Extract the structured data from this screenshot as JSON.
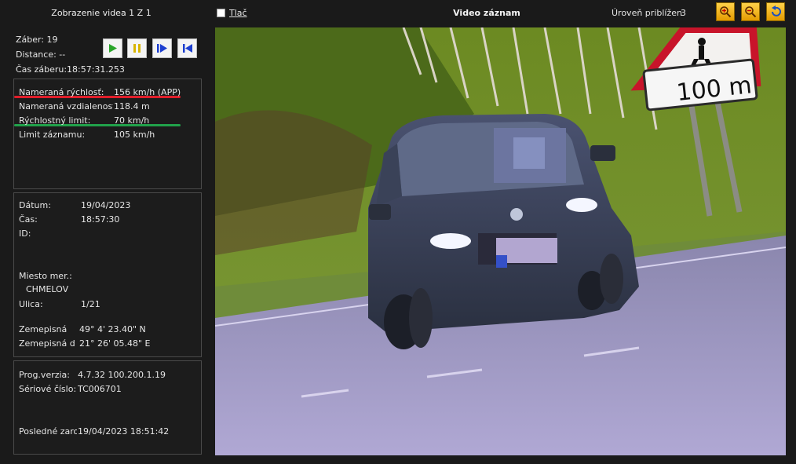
{
  "left_panel": {
    "title": "Zobrazenie videa 1 Z 1",
    "frame": "Záber: 19",
    "distance": "Distance: --",
    "time_label": "Čas záberu:",
    "time_value": "18:57:31.253"
  },
  "measurements": [
    {
      "label": "Nameraná rýchlosť:",
      "value": "156 km/h (APP)"
    },
    {
      "label": "Nameraná vzdialenosť:",
      "value": "118.4 m"
    },
    {
      "label": "Rýchlostný limit:",
      "value": "70 km/h"
    },
    {
      "label": "Limit záznamu:",
      "value": "105 km/h"
    }
  ],
  "info": [
    {
      "label": "Dátum:",
      "value": "19/04/2023"
    },
    {
      "label": "Čas:",
      "value": "18:57:30"
    },
    {
      "label": "ID:",
      "value": ""
    },
    {
      "label": "Miesto mer.:",
      "value": ""
    },
    {
      "label": "CHMELOV",
      "value": ""
    },
    {
      "label": "Ulica:",
      "value": "1/21"
    },
    {
      "label": "Zemepisná",
      "value": "49° 4' 23.40\" N"
    },
    {
      "label": "Zemepisná d",
      "value": "21° 26' 05.48\" E"
    }
  ],
  "device": [
    {
      "label": "Prog.verzia:",
      "value": "4.7.32  100.200.1.19"
    },
    {
      "label": "Sériové číslo:",
      "value": "TC006701"
    },
    {
      "label": "Posledné zarov",
      "value": "19/04/2023  18:51:42"
    }
  ],
  "toolbar": {
    "print_label": "Tlač",
    "video_title": "Video záznam",
    "zoom_label": "Úroveň priblížen",
    "zoom_value": "3"
  },
  "scene": {
    "sign_text": "100 m"
  },
  "colors": {
    "red_marker": "#e01e2a",
    "green_marker": "#21a24a",
    "zoom_button": "#f2b300",
    "play_green": "#2aa52a",
    "pause_yellow": "#d8b400",
    "nav_blue": "#1d3fd0"
  }
}
